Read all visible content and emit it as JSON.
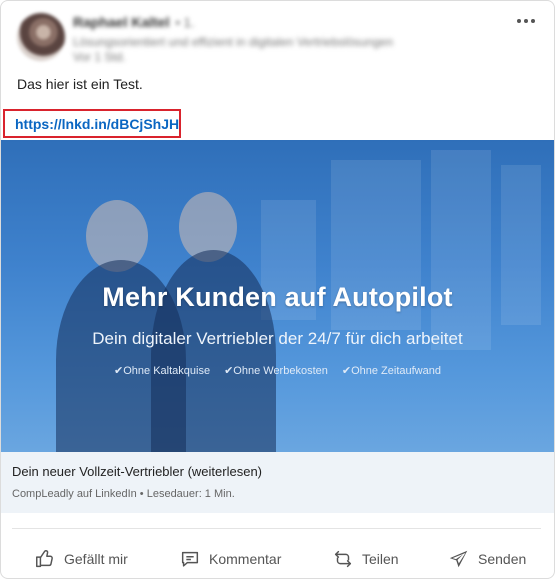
{
  "post": {
    "author": {
      "name": "Raphael Kaltel",
      "degree": "• 1.",
      "headline": "Lösungsorientiert und effizient in digitalen Vertriebslösungen",
      "time": "Vor 1 Std."
    },
    "text": "Das hier ist ein Test.",
    "link": "https://lnkd.in/dBCjShJH",
    "image": {
      "title": "Mehr Kunden auf Autopilot",
      "subtitle": "Dein digitaler Vertriebler der 24/7 für dich arbeitet",
      "bullets": [
        "✔Ohne Kaltakquise",
        "✔Ohne Werbekosten",
        "✔Ohne Zeitaufwand"
      ]
    },
    "preview": {
      "title": "Dein neuer Vollzeit-Vertriebler (weiterlesen)",
      "meta": "CompLeadly auf LinkedIn • Lesedauer: 1 Min."
    }
  },
  "actions": {
    "like": "Gefällt mir",
    "comment": "Kommentar",
    "share": "Teilen",
    "send": "Senden"
  },
  "colors": {
    "link": "#0a66c2",
    "highlight": "#d9232d",
    "hero": "#3f82cd",
    "preview_bg": "#eef3f8"
  },
  "icons": {
    "more": "more-horizontal-icon",
    "like": "thumbs-up-icon",
    "comment": "comment-bubble-icon",
    "share": "repost-icon",
    "send": "paper-plane-icon"
  }
}
